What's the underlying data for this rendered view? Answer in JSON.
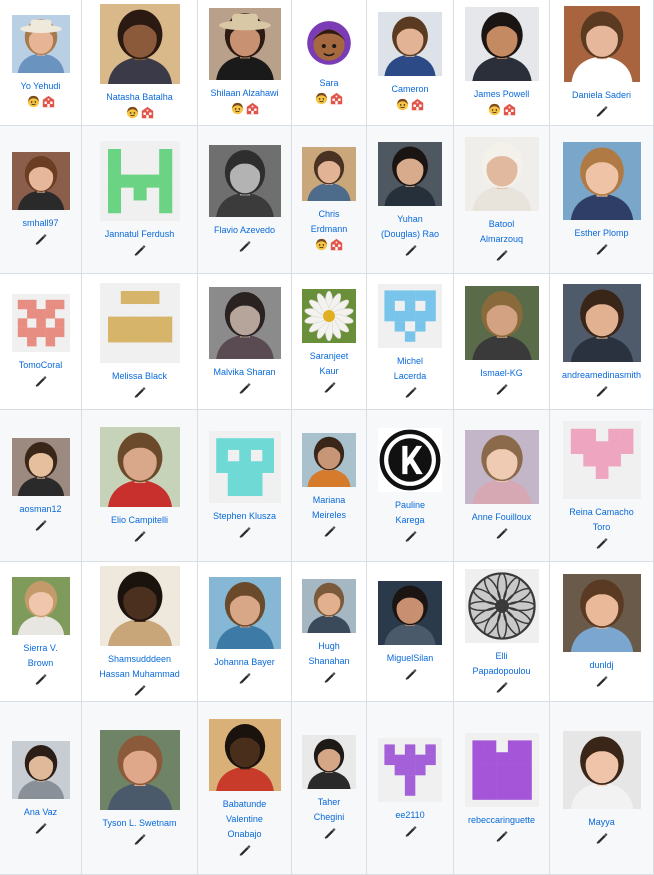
{
  "contributors": [
    [
      {
        "lines": [
          "Yo Yehudi"
        ],
        "avatar": {
          "kind": "photo",
          "bg": "#b9cfe4",
          "skin": "#e7b595",
          "hair": "#a8794a",
          "cloth": "#6a93c0",
          "hat": "#efe9dc",
          "size": 58
        },
        "badges": [
          "mentoring",
          "infra"
        ]
      },
      {
        "lines": [
          "Natasha Batalha"
        ],
        "avatar": {
          "kind": "photo",
          "bg": "#d9b88a",
          "skin": "#8a5a3a",
          "hair": "#2a1a12",
          "cloth": "#3b3a48",
          "size": 80
        },
        "badges": [
          "mentoring",
          "infra"
        ]
      },
      {
        "lines": [
          "Shilaan Alzahawi"
        ],
        "avatar": {
          "kind": "photo",
          "bg": "#b8a08a",
          "skin": "#c89272",
          "hair": "#2d1b12",
          "cloth": "#1a1a1a",
          "hat": "#d9c8a6",
          "size": 72
        },
        "badges": [
          "mentoring",
          "infra"
        ]
      },
      {
        "lines": [
          "Sara"
        ],
        "avatar": {
          "kind": "cartoon",
          "bg": "#ffffff",
          "skin": "#a6683f",
          "hair": "#2d1b12",
          "cloth": "#7a3bb5",
          "size": 52
        },
        "badges": [
          "mentoring",
          "infra"
        ]
      },
      {
        "lines": [
          "Cameron"
        ],
        "avatar": {
          "kind": "photo",
          "bg": "#dde2e8",
          "skin": "#e2b394",
          "hair": "#5a3b22",
          "cloth": "#2b4a86",
          "size": 64
        },
        "badges": [
          "mentoring",
          "infra"
        ]
      },
      {
        "lines": [
          "James Powell"
        ],
        "avatar": {
          "kind": "photo",
          "bg": "#e5e7ea",
          "skin": "#c48a62",
          "hair": "#1a1512",
          "cloth": "#2a2f3a",
          "size": 74
        },
        "badges": [
          "mentoring",
          "infra"
        ]
      },
      {
        "lines": [
          "Daniela Saderi"
        ],
        "avatar": {
          "kind": "photo",
          "bg": "#a8643e",
          "skin": "#e6b79a",
          "hair": "#5a3b22",
          "cloth": "#ffffff",
          "size": 76
        },
        "badges": [
          "code"
        ]
      }
    ],
    [
      {
        "lines": [
          "smhall97"
        ],
        "avatar": {
          "kind": "photo",
          "bg": "#8a5e4a",
          "skin": "#e6b79a",
          "hair": "#6b3e23",
          "cloth": "#2a2a2a",
          "size": 58
        },
        "badges": [
          "code"
        ]
      },
      {
        "lines": [
          "Jannatul Ferdush"
        ],
        "avatar": {
          "kind": "identicon",
          "fg": "#6ad384",
          "pattern": [
            "10001",
            "10001",
            "11111",
            "10101",
            "10001"
          ],
          "size": 80
        },
        "badges": [
          "code"
        ]
      },
      {
        "lines": [
          "Flavio Azevedo"
        ],
        "avatar": {
          "kind": "photo",
          "bg": "#6f6f6f",
          "skin": "#b3b3b3",
          "hair": "#2e2e2e",
          "cloth": "#3b3b3b",
          "size": 72
        },
        "badges": [
          "code"
        ]
      },
      {
        "lines": [
          "Chris",
          "Erdmann"
        ],
        "avatar": {
          "kind": "photo",
          "bg": "#c9a77a",
          "skin": "#e2b394",
          "hair": "#4a3222",
          "cloth": "#4d6b8a",
          "size": 54
        },
        "badges": [
          "mentoring",
          "infra"
        ]
      },
      {
        "lines": [
          "Yuhan",
          "(Douglas) Rao"
        ],
        "avatar": {
          "kind": "photo",
          "bg": "#4f5860",
          "skin": "#d8ab8c",
          "hair": "#1a1512",
          "cloth": "#26303a",
          "size": 64
        },
        "badges": [
          "code"
        ]
      },
      {
        "lines": [
          "Batool",
          "Almarzouq"
        ],
        "avatar": {
          "kind": "photo",
          "bg": "#efeeea",
          "skin": "#e0b99e",
          "hair": "#f4f1ea",
          "cloth": "#e8e4dc",
          "size": 74
        },
        "badges": [
          "code"
        ]
      },
      {
        "lines": [
          "Esther Plomp"
        ],
        "avatar": {
          "kind": "photo",
          "bg": "#7aa6c9",
          "skin": "#efc3a5",
          "hair": "#b07a45",
          "cloth": "#2f3e66",
          "size": 78
        },
        "badges": [
          "code"
        ]
      }
    ],
    [
      {
        "lines": [
          "TomoCoral"
        ],
        "avatar": {
          "kind": "identicon",
          "fg": "#e78d82",
          "pattern": [
            "11011",
            "01110",
            "10101",
            "11111",
            "01010"
          ],
          "size": 58
        },
        "badges": [
          "code"
        ]
      },
      {
        "lines": [
          "Melissa Black"
        ],
        "avatar": {
          "kind": "identicon",
          "fg": "#d6b56a",
          "pattern": [
            "01110",
            "00000",
            "11111",
            "11111",
            "00000"
          ],
          "size": 80
        },
        "badges": [
          "code"
        ]
      },
      {
        "lines": [
          "Malvika Sharan"
        ],
        "avatar": {
          "kind": "photo",
          "bg": "#8b8b8b",
          "skin": "#b5a59a",
          "hair": "#2a2220",
          "cloth": "#5a4a52",
          "size": 72
        },
        "badges": [
          "code"
        ]
      },
      {
        "lines": [
          "Saranjeet",
          "Kaur"
        ],
        "avatar": {
          "kind": "flower",
          "bg": "#6a8f3a",
          "petal": "#f4f2ee",
          "center": "#e0b020",
          "size": 54
        },
        "badges": [
          "code"
        ]
      },
      {
        "lines": [
          "Michel",
          "Lacerda"
        ],
        "avatar": {
          "kind": "identicon",
          "fg": "#79c4ea",
          "pattern": [
            "11111",
            "10101",
            "11111",
            "01010",
            "00100"
          ],
          "size": 64
        },
        "badges": [
          "code"
        ]
      },
      {
        "lines": [
          "Ismael-KG"
        ],
        "avatar": {
          "kind": "photo",
          "bg": "#5a6b4a",
          "skin": "#d3a283",
          "hair": "#8a6a3a",
          "cloth": "#3a3a3a",
          "size": 74
        },
        "badges": [
          "code"
        ]
      },
      {
        "lines": [
          "andreamedinasmith"
        ],
        "avatar": {
          "kind": "photo",
          "bg": "#4f5a6a",
          "skin": "#e1b192",
          "hair": "#3a2618",
          "cloth": "#2a3240",
          "size": 78
        },
        "badges": [
          "code"
        ]
      }
    ],
    [
      {
        "lines": [
          "aosman12"
        ],
        "avatar": {
          "kind": "photo",
          "bg": "#9c8a80",
          "skin": "#e6bf9f",
          "hair": "#3a2618",
          "cloth": "#2a2a2a",
          "size": 58
        },
        "badges": [
          "code"
        ]
      },
      {
        "lines": [
          "Elio Campitelli"
        ],
        "avatar": {
          "kind": "photo",
          "bg": "#c7d3b9",
          "skin": "#d9a78a",
          "hair": "#6a4a2a",
          "cloth": "#c8302e",
          "size": 80
        },
        "badges": [
          "code"
        ]
      },
      {
        "lines": [
          "Stephen Klusza"
        ],
        "avatar": {
          "kind": "identicon",
          "fg": "#6fdad5",
          "pattern": [
            "11111",
            "10101",
            "11111",
            "01110",
            "01110"
          ],
          "size": 72
        },
        "badges": [
          "code"
        ]
      },
      {
        "lines": [
          "Mariana",
          "Meireles"
        ],
        "avatar": {
          "kind": "photo",
          "bg": "#a9c1cc",
          "skin": "#c79676",
          "hair": "#3a2618",
          "cloth": "#d67a2c",
          "size": 54
        },
        "badges": [
          "code"
        ]
      },
      {
        "lines": [
          "Pauline",
          "Karega"
        ],
        "avatar": {
          "kind": "logo",
          "bg": "#ffffff",
          "ring": "#111111",
          "letter": "K",
          "size": 64
        },
        "badges": [
          "code"
        ]
      },
      {
        "lines": [
          "Anne Fouilloux"
        ],
        "avatar": {
          "kind": "photo",
          "bg": "#c3b6c8",
          "skin": "#efcbb4",
          "hair": "#8a6a4a",
          "cloth": "#d6a8b4",
          "size": 74
        },
        "badges": [
          "code"
        ]
      },
      {
        "lines": [
          "Reina Camacho",
          "Toro"
        ],
        "avatar": {
          "kind": "identicon",
          "fg": "#eea6c0",
          "pattern": [
            "11011",
            "11111",
            "01110",
            "00100",
            "00000"
          ],
          "size": 78
        },
        "badges": [
          "code"
        ]
      }
    ],
    [
      {
        "lines": [
          "Sierra V.",
          "Brown"
        ],
        "avatar": {
          "kind": "photo",
          "bg": "#7f9b5c",
          "skin": "#f0c7ad",
          "hair": "#c59a6a",
          "cloth": "#e8e6e0",
          "size": 58
        },
        "badges": [
          "code"
        ]
      },
      {
        "lines": [
          "Shamsudddeen",
          "Hassan Muhammad"
        ],
        "avatar": {
          "kind": "photo",
          "bg": "#efe8dc",
          "skin": "#4b3020",
          "hair": "#1a120c",
          "cloth": "#c9a57a",
          "size": 80
        },
        "badges": [
          "code"
        ]
      },
      {
        "lines": [
          "Johanna Bayer"
        ],
        "avatar": {
          "kind": "photo",
          "bg": "#86b7d4",
          "skin": "#d8a788",
          "hair": "#6a4a2a",
          "cloth": "#3d7ba6",
          "size": 72
        },
        "badges": [
          "code"
        ]
      },
      {
        "lines": [
          "Hugh",
          "Shanahan"
        ],
        "avatar": {
          "kind": "photo",
          "bg": "#a6b7c4",
          "skin": "#e2b08e",
          "hair": "#7a5a3a",
          "cloth": "#3a4a5a",
          "size": 54
        },
        "badges": [
          "code"
        ]
      },
      {
        "lines": [
          "MiguelSilan"
        ],
        "avatar": {
          "kind": "photo",
          "bg": "#2a3a4a",
          "skin": "#c89070",
          "hair": "#1a1512",
          "cloth": "#4a5a6a",
          "size": 64
        },
        "badges": [
          "code"
        ]
      },
      {
        "lines": [
          "Elli",
          "Papadopoulou"
        ],
        "avatar": {
          "kind": "mandala",
          "bg": "#efefef",
          "fg": "#3a3a3a",
          "size": 74
        },
        "badges": [
          "code"
        ]
      },
      {
        "lines": [
          "dunldj"
        ],
        "avatar": {
          "kind": "photo",
          "bg": "#6a5a4a",
          "skin": "#e9b99a",
          "hair": "#5a3a22",
          "cloth": "#7aa6cf",
          "size": 78
        },
        "badges": [
          "code"
        ]
      }
    ],
    [
      {
        "lines": [
          "Ana Vaz"
        ],
        "avatar": {
          "kind": "photo",
          "bg": "#c8cdd4",
          "skin": "#e0b89a",
          "hair": "#2a1e16",
          "cloth": "#8a9098",
          "size": 58
        },
        "badges": [
          "code"
        ]
      },
      {
        "lines": [
          "Tyson L. Swetnam"
        ],
        "avatar": {
          "kind": "photo",
          "bg": "#6f8466",
          "skin": "#e0a88a",
          "hair": "#8a5a3a",
          "cloth": "#4a5a6a",
          "size": 80
        },
        "badges": [
          "code"
        ]
      },
      {
        "lines": [
          "Babatunde",
          "Valentine",
          "Onabajo"
        ],
        "avatar": {
          "kind": "photo",
          "bg": "#d9b077",
          "skin": "#4a2e1c",
          "hair": "#1a120c",
          "cloth": "#c83a2a",
          "size": 72
        },
        "badges": [
          "code"
        ]
      },
      {
        "lines": [
          "Taher",
          "Chegini"
        ],
        "avatar": {
          "kind": "photo",
          "bg": "#e9e9e9",
          "skin": "#d6a787",
          "hair": "#1e1a18",
          "cloth": "#2a2a2a",
          "size": 54
        },
        "badges": [
          "code"
        ]
      },
      {
        "lines": [
          "ee2110"
        ],
        "avatar": {
          "kind": "identicon",
          "fg": "#a360d8",
          "pattern": [
            "10101",
            "11111",
            "01110",
            "00100",
            "00100"
          ],
          "size": 64
        },
        "badges": [
          "code"
        ]
      },
      {
        "lines": [
          "rebeccaringuette"
        ],
        "avatar": {
          "kind": "identicon",
          "fg": "#a455d8",
          "pattern": [
            "11011",
            "11111",
            "11111",
            "11111",
            "11111"
          ],
          "size": 74
        },
        "badges": [
          "code"
        ]
      },
      {
        "lines": [
          "Mayya"
        ],
        "avatar": {
          "kind": "photo",
          "bg": "#e6e6e6",
          "skin": "#efc4a8",
          "hair": "#3a2618",
          "cloth": "#f2f2f2",
          "size": 78
        },
        "badges": [
          "code"
        ]
      }
    ]
  ]
}
